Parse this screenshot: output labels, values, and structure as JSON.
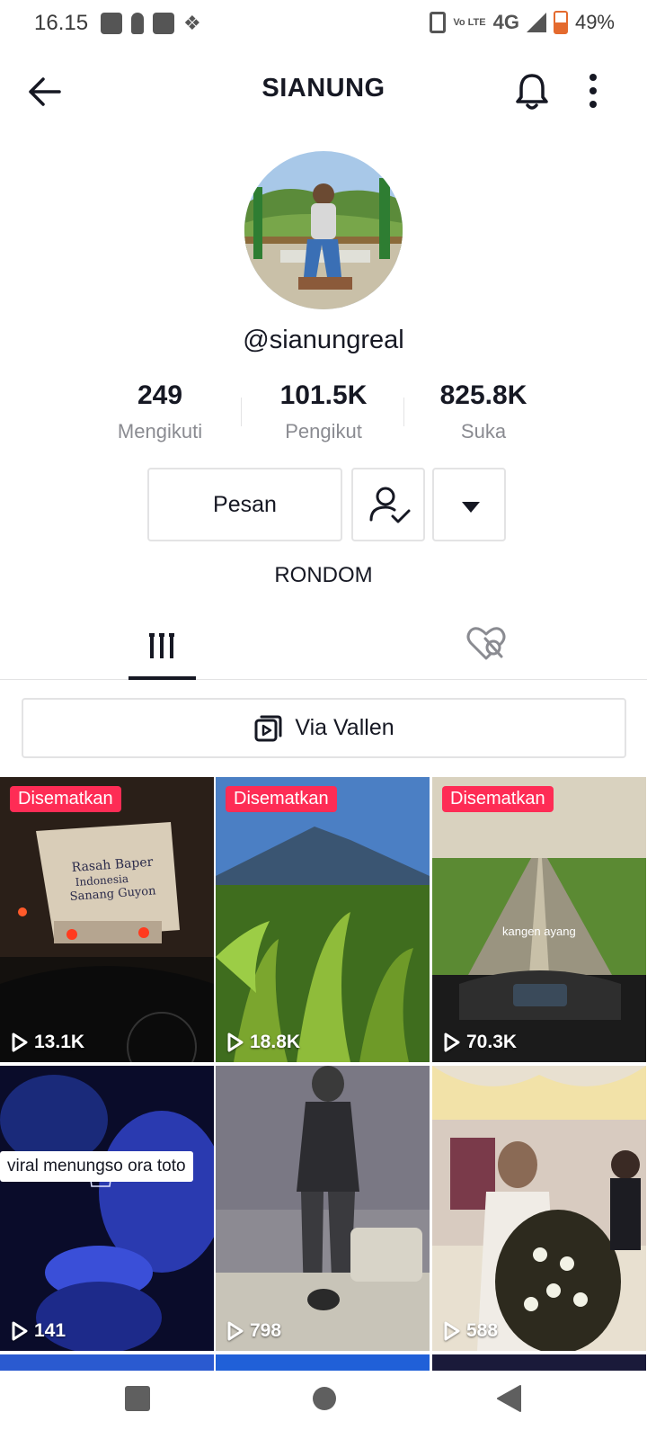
{
  "status_bar": {
    "time": "16.15",
    "network": "4G",
    "lte_label": "Vo LTE",
    "battery": "49%"
  },
  "header": {
    "title": "SIANUNG"
  },
  "profile": {
    "username": "@sianungreal",
    "stats": [
      {
        "value": "249",
        "label": "Mengikuti"
      },
      {
        "value": "101.5K",
        "label": "Pengikut"
      },
      {
        "value": "825.8K",
        "label": "Suka"
      }
    ],
    "message_label": "Pesan",
    "bio": "RONDOM"
  },
  "playlist": {
    "label": "Via Vallen"
  },
  "videos": [
    {
      "pinned_label": "Disematkan",
      "views": "13.1K",
      "overlay_text": "Rasah Baper Indonesia Sanang Guyon"
    },
    {
      "pinned_label": "Disematkan",
      "views": "18.8K"
    },
    {
      "pinned_label": "Disematkan",
      "views": "70.3K",
      "caption": "kangen ayang"
    },
    {
      "views": "141",
      "caption": "viral menungso ora toto"
    },
    {
      "views": "798"
    },
    {
      "views": "588"
    }
  ],
  "colors": {
    "accent": "#fe2c55",
    "text": "#161823",
    "muted": "#8a8b91",
    "border": "#e3e3e4"
  }
}
